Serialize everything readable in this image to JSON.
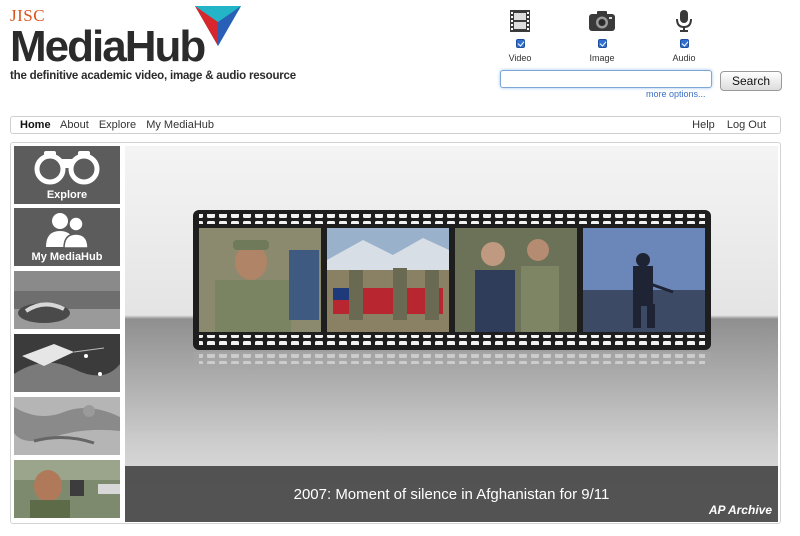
{
  "logo": {
    "org": "JISC",
    "brand": "MediaHub",
    "tagline": "the definitive academic video, image & audio resource"
  },
  "media_types": [
    {
      "label": "Video",
      "icon": "film-icon",
      "checked": true
    },
    {
      "label": "Image",
      "icon": "camera-icon",
      "checked": true
    },
    {
      "label": "Audio",
      "icon": "microphone-icon",
      "checked": true
    }
  ],
  "search": {
    "value": "",
    "placeholder": "",
    "button_label": "Search",
    "more_options": "more options..."
  },
  "nav": {
    "left": [
      "Home",
      "About",
      "Explore",
      "My MediaHub"
    ],
    "active": "Home",
    "right": [
      "Help",
      "Log Out"
    ]
  },
  "sidebar": {
    "explore_label": "Explore",
    "mymediahub_label": "My MediaHub"
  },
  "hero": {
    "caption": "2007: Moment of silence in Afghanistan for 9/11",
    "credit": "AP Archive"
  },
  "colors": {
    "jisc_orange": "#d9541e",
    "brand_dark": "#2b2b2b",
    "link_blue": "#3a6fc4",
    "tile_gray": "#5c5c5c",
    "caption_bg": "#464646"
  }
}
